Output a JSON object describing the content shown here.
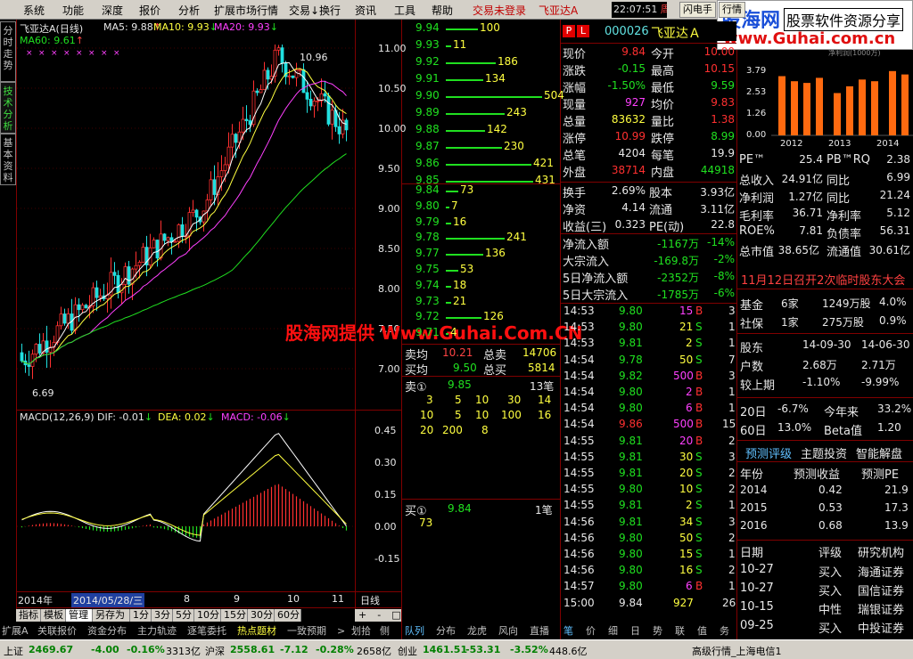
{
  "menu": [
    "系统",
    "功能",
    "深度",
    "报价",
    "分析",
    "扩展市场行情",
    "交易↓换行",
    "资讯",
    "工具",
    "帮助"
  ],
  "menu_status": [
    "交易未登录",
    "飞亚达A"
  ],
  "clock": {
    "time": "22:07:51",
    "day": "周二"
  },
  "flash_buttons": [
    "闪电手",
    "行情"
  ],
  "watermark": {
    "top_blue": "股海网",
    "top_right": "股票软件资源分享",
    "url": "www.Guhai.com.cn",
    "center": "股海网提供 Www.Guhai.Com.CN",
    "bar_title": "净利润(1000万)",
    "years": [
      "2012",
      "2013",
      "2014"
    ],
    "yaxis": [
      "3.79",
      "2.53",
      "1.26",
      "0.00"
    ],
    "bars": [
      3.5,
      3.2,
      3.1,
      3.4,
      2.5,
      2.9,
      3.3,
      3.2,
      3.8,
      3.6
    ]
  },
  "side_tabs": [
    "分时走势",
    "技术分析",
    "基本资料"
  ],
  "chart_header": {
    "name": "飞亚达A(日线)",
    "ma5": "MA5: 9.88",
    "ma10": "MA10: 9.93",
    "ma20": "MA20: 9.93",
    "ma60": "MA60: 9.61"
  },
  "macd_header": {
    "name": "MACD(12,26,9)",
    "dif": "DIF: -0.01",
    "dea": "DEA: 0.02",
    "macd": "MACD: -0.06"
  },
  "chart_data": [
    {
      "type": "candlestick",
      "title": "飞亚达A(日线)",
      "yaxis": [
        "11.00",
        "10.50",
        "10.00",
        "9.50",
        "9.00",
        "8.50",
        "8.00",
        "7.50",
        "7.00"
      ],
      "high_label": "10.96",
      "low_label": "6.69"
    },
    {
      "type": "bar",
      "title": "MACD(12,26,9)",
      "yaxis": [
        "0.45",
        "0.30",
        "0.15",
        "0.00",
        "-0.15"
      ]
    }
  ],
  "date_axis": {
    "year": "2014年",
    "cursor": "2014/05/28/三",
    "months": [
      "8",
      "9",
      "10",
      "11"
    ],
    "period": "日线"
  },
  "order_book": {
    "asks": [
      {
        "p": "9.94",
        "v": "100",
        "w": 36
      },
      {
        "p": "9.93",
        "v": "11",
        "w": 6
      },
      {
        "p": "9.92",
        "v": "186",
        "w": 56
      },
      {
        "p": "9.91",
        "v": "134",
        "w": 42
      },
      {
        "p": "9.90",
        "v": "504",
        "w": 108
      },
      {
        "p": "9.89",
        "v": "243",
        "w": 66
      },
      {
        "p": "9.88",
        "v": "142",
        "w": 44
      },
      {
        "p": "9.87",
        "v": "230",
        "w": 63
      },
      {
        "p": "9.86",
        "v": "421",
        "w": 96
      },
      {
        "p": "9.85",
        "v": "431",
        "w": 98
      }
    ],
    "bids": [
      {
        "p": "9.84",
        "v": "73",
        "w": 14
      },
      {
        "p": "9.80",
        "v": "7",
        "w": 4
      },
      {
        "p": "9.79",
        "v": "16",
        "w": 6
      },
      {
        "p": "9.78",
        "v": "241",
        "w": 66
      },
      {
        "p": "9.77",
        "v": "136",
        "w": 42
      },
      {
        "p": "9.75",
        "v": "53",
        "w": 14
      },
      {
        "p": "9.74",
        "v": "18",
        "w": 6
      },
      {
        "p": "9.73",
        "v": "21",
        "w": 6
      },
      {
        "p": "9.72",
        "v": "126",
        "w": 40
      },
      {
        "p": "9.71",
        "v": "4",
        "w": 3
      }
    ],
    "sell_avg_label": "卖均",
    "sell_avg": "10.21",
    "total_sell_label": "总卖",
    "total_sell": "14706",
    "buy_avg_label": "买均",
    "buy_avg": "9.50",
    "total_buy_label": "总买",
    "total_buy": "5814",
    "sell1_label": "卖①",
    "sell1_price": "9.85",
    "sell1_count": "13笔",
    "sell1_queue": [
      "3",
      "5",
      "10",
      "30",
      "14",
      "10",
      "5",
      "10",
      "100",
      "16",
      "20",
      "200",
      "8"
    ],
    "buy1_label": "买①",
    "buy1_price": "9.84",
    "buy1_count": "1笔",
    "buy1_queue": [
      "73"
    ]
  },
  "quote": {
    "code": "000026",
    "name": "飞亚达Ａ",
    "rows": [
      [
        "现价",
        "9.84",
        "今开",
        "10.00"
      ],
      [
        "涨跌",
        "-0.15",
        "最高",
        "10.15"
      ],
      [
        "涨幅",
        "-1.50%",
        "最低",
        "9.59"
      ],
      [
        "现量",
        "927",
        "均价",
        "9.83"
      ],
      [
        "总量",
        "83632",
        "量比",
        "1.38"
      ],
      [
        "涨停",
        "10.99",
        "跌停",
        "8.99"
      ],
      [
        "总笔",
        "4204",
        "每笔",
        "19.9"
      ],
      [
        "外盘",
        "38714",
        "内盘",
        "44918"
      ]
    ],
    "rows2": [
      [
        "换手",
        "2.69%",
        "股本",
        "3.93亿"
      ],
      [
        "净资",
        "4.14",
        "流通",
        "3.11亿"
      ],
      [
        "收益(三)",
        "0.323",
        "PE(动)",
        "22.8"
      ]
    ],
    "flows": [
      [
        "净流入额",
        "-1167万",
        "-14%"
      ],
      [
        "大宗流入",
        "-169.8万",
        "-2%"
      ],
      [
        "5日净流入额",
        "-2352万",
        "-8%"
      ],
      [
        "5日大宗流入",
        "-1785万",
        "-6%"
      ]
    ]
  },
  "ticks": [
    [
      "14:53",
      "9.80",
      "15",
      "B",
      "3"
    ],
    [
      "14:53",
      "9.80",
      "21",
      "S",
      "1"
    ],
    [
      "14:53",
      "9.81",
      "2",
      "S",
      "1"
    ],
    [
      "14:54",
      "9.78",
      "50",
      "S",
      "7"
    ],
    [
      "14:54",
      "9.82",
      "500",
      "B",
      "3"
    ],
    [
      "14:54",
      "9.80",
      "2",
      "B",
      "1"
    ],
    [
      "14:54",
      "9.80",
      "6",
      "B",
      "1"
    ],
    [
      "14:54",
      "9.86",
      "500",
      "B",
      "15"
    ],
    [
      "14:55",
      "9.81",
      "20",
      "B",
      "2"
    ],
    [
      "14:55",
      "9.81",
      "30",
      "S",
      "3"
    ],
    [
      "14:55",
      "9.81",
      "20",
      "S",
      "2"
    ],
    [
      "14:55",
      "9.80",
      "10",
      "S",
      "2"
    ],
    [
      "14:55",
      "9.81",
      "2",
      "S",
      "1"
    ],
    [
      "14:56",
      "9.81",
      "34",
      "S",
      "3"
    ],
    [
      "14:56",
      "9.80",
      "50",
      "S",
      "2"
    ],
    [
      "14:56",
      "9.80",
      "15",
      "S",
      "1"
    ],
    [
      "14:56",
      "9.80",
      "16",
      "S",
      "2"
    ],
    [
      "14:57",
      "9.80",
      "6",
      "B",
      "1"
    ],
    [
      "15:00",
      "9.84",
      "927",
      "",
      "26"
    ]
  ],
  "fin": {
    "rows": [
      [
        "PE™",
        "25.4",
        "PB™RQ",
        "2.38"
      ],
      [
        "总收入",
        "24.91亿",
        "同比",
        "6.99"
      ],
      [
        "净利润",
        "1.27亿",
        "同比",
        "21.24"
      ],
      [
        "毛利率",
        "36.71",
        "净利率",
        "5.12"
      ],
      [
        "ROE%",
        "7.81",
        "负债率",
        "56.31"
      ],
      [
        "总市值",
        "38.65亿",
        "流通值",
        "30.61亿"
      ]
    ],
    "notice": "11月12日召开2次临时股东大会",
    "funds": [
      [
        "基金",
        "6家",
        "1249万股",
        "4.0%"
      ],
      [
        "社保",
        "1家",
        "275万股",
        "0.9%"
      ]
    ],
    "holders": [
      [
        "股东",
        "14-09-30",
        "14-06-30"
      ],
      [
        "户数",
        "2.68万",
        "2.71万"
      ],
      [
        "较上期",
        "-1.10%",
        "-9.99%"
      ]
    ],
    "perf": [
      [
        "20日",
        "-6.7%",
        "今年来",
        "33.2%"
      ],
      [
        "60日",
        "13.0%",
        "Beta值",
        "1.20"
      ]
    ],
    "tabs": [
      "预测评级",
      "主题投资",
      "智能解盘"
    ],
    "forecast_head": [
      "年份",
      "预测收益",
      "预测PE"
    ],
    "forecast": [
      [
        "2014",
        "0.42",
        "21.9"
      ],
      [
        "2015",
        "0.53",
        "17.3"
      ],
      [
        "2016",
        "0.68",
        "13.9"
      ]
    ],
    "rating_head": [
      "日期",
      "评级",
      "研究机构"
    ],
    "ratings": [
      [
        "10-27",
        "买入",
        "海通证券"
      ],
      [
        "10-27",
        "买入",
        "国信证券"
      ],
      [
        "10-15",
        "中性",
        "瑞银证券"
      ],
      [
        "09-25",
        "买入",
        "中投证券"
      ]
    ]
  },
  "bottom_tabs": [
    "指标",
    "模板",
    "管理",
    "另存为",
    "1分",
    "3分",
    "5分",
    "10分",
    "15分",
    "30分",
    "60分"
  ],
  "bottom_tabs2": [
    "扩展A",
    "关联报价",
    "资金分布",
    "主力轨迹",
    "逐笔委托",
    "热点题材",
    "一致预期",
    ">",
    "划拾",
    "侧"
  ],
  "right_tabs": [
    "队列",
    "分布",
    "龙虎",
    "风向",
    "直播"
  ],
  "right_tabs2": [
    "笔",
    "价",
    "细",
    "日",
    "势",
    "联",
    "值",
    "务"
  ],
  "status": {
    "sh_label": "上证",
    "sh_val": "2469.67",
    "sh_chg": "-4.00",
    "sh_pct": "-0.16%",
    "sh_amt": "3313亿",
    "sz_label": "沪深",
    "sz_val": "2558.61",
    "sz_chg": "-7.12",
    "sz_pct": "-0.28%",
    "sz_amt": "2658亿",
    "cy_label": "创业",
    "cy_val": "1461.51",
    "cy_chg": "-53.31",
    "cy_pct": "-3.52%",
    "cy_amt": "448.6亿",
    "right": "高级行情_上海电信1"
  },
  "colors": {
    "up": "#ff3030",
    "down": "#20e020",
    "panel_border": "#800000"
  }
}
